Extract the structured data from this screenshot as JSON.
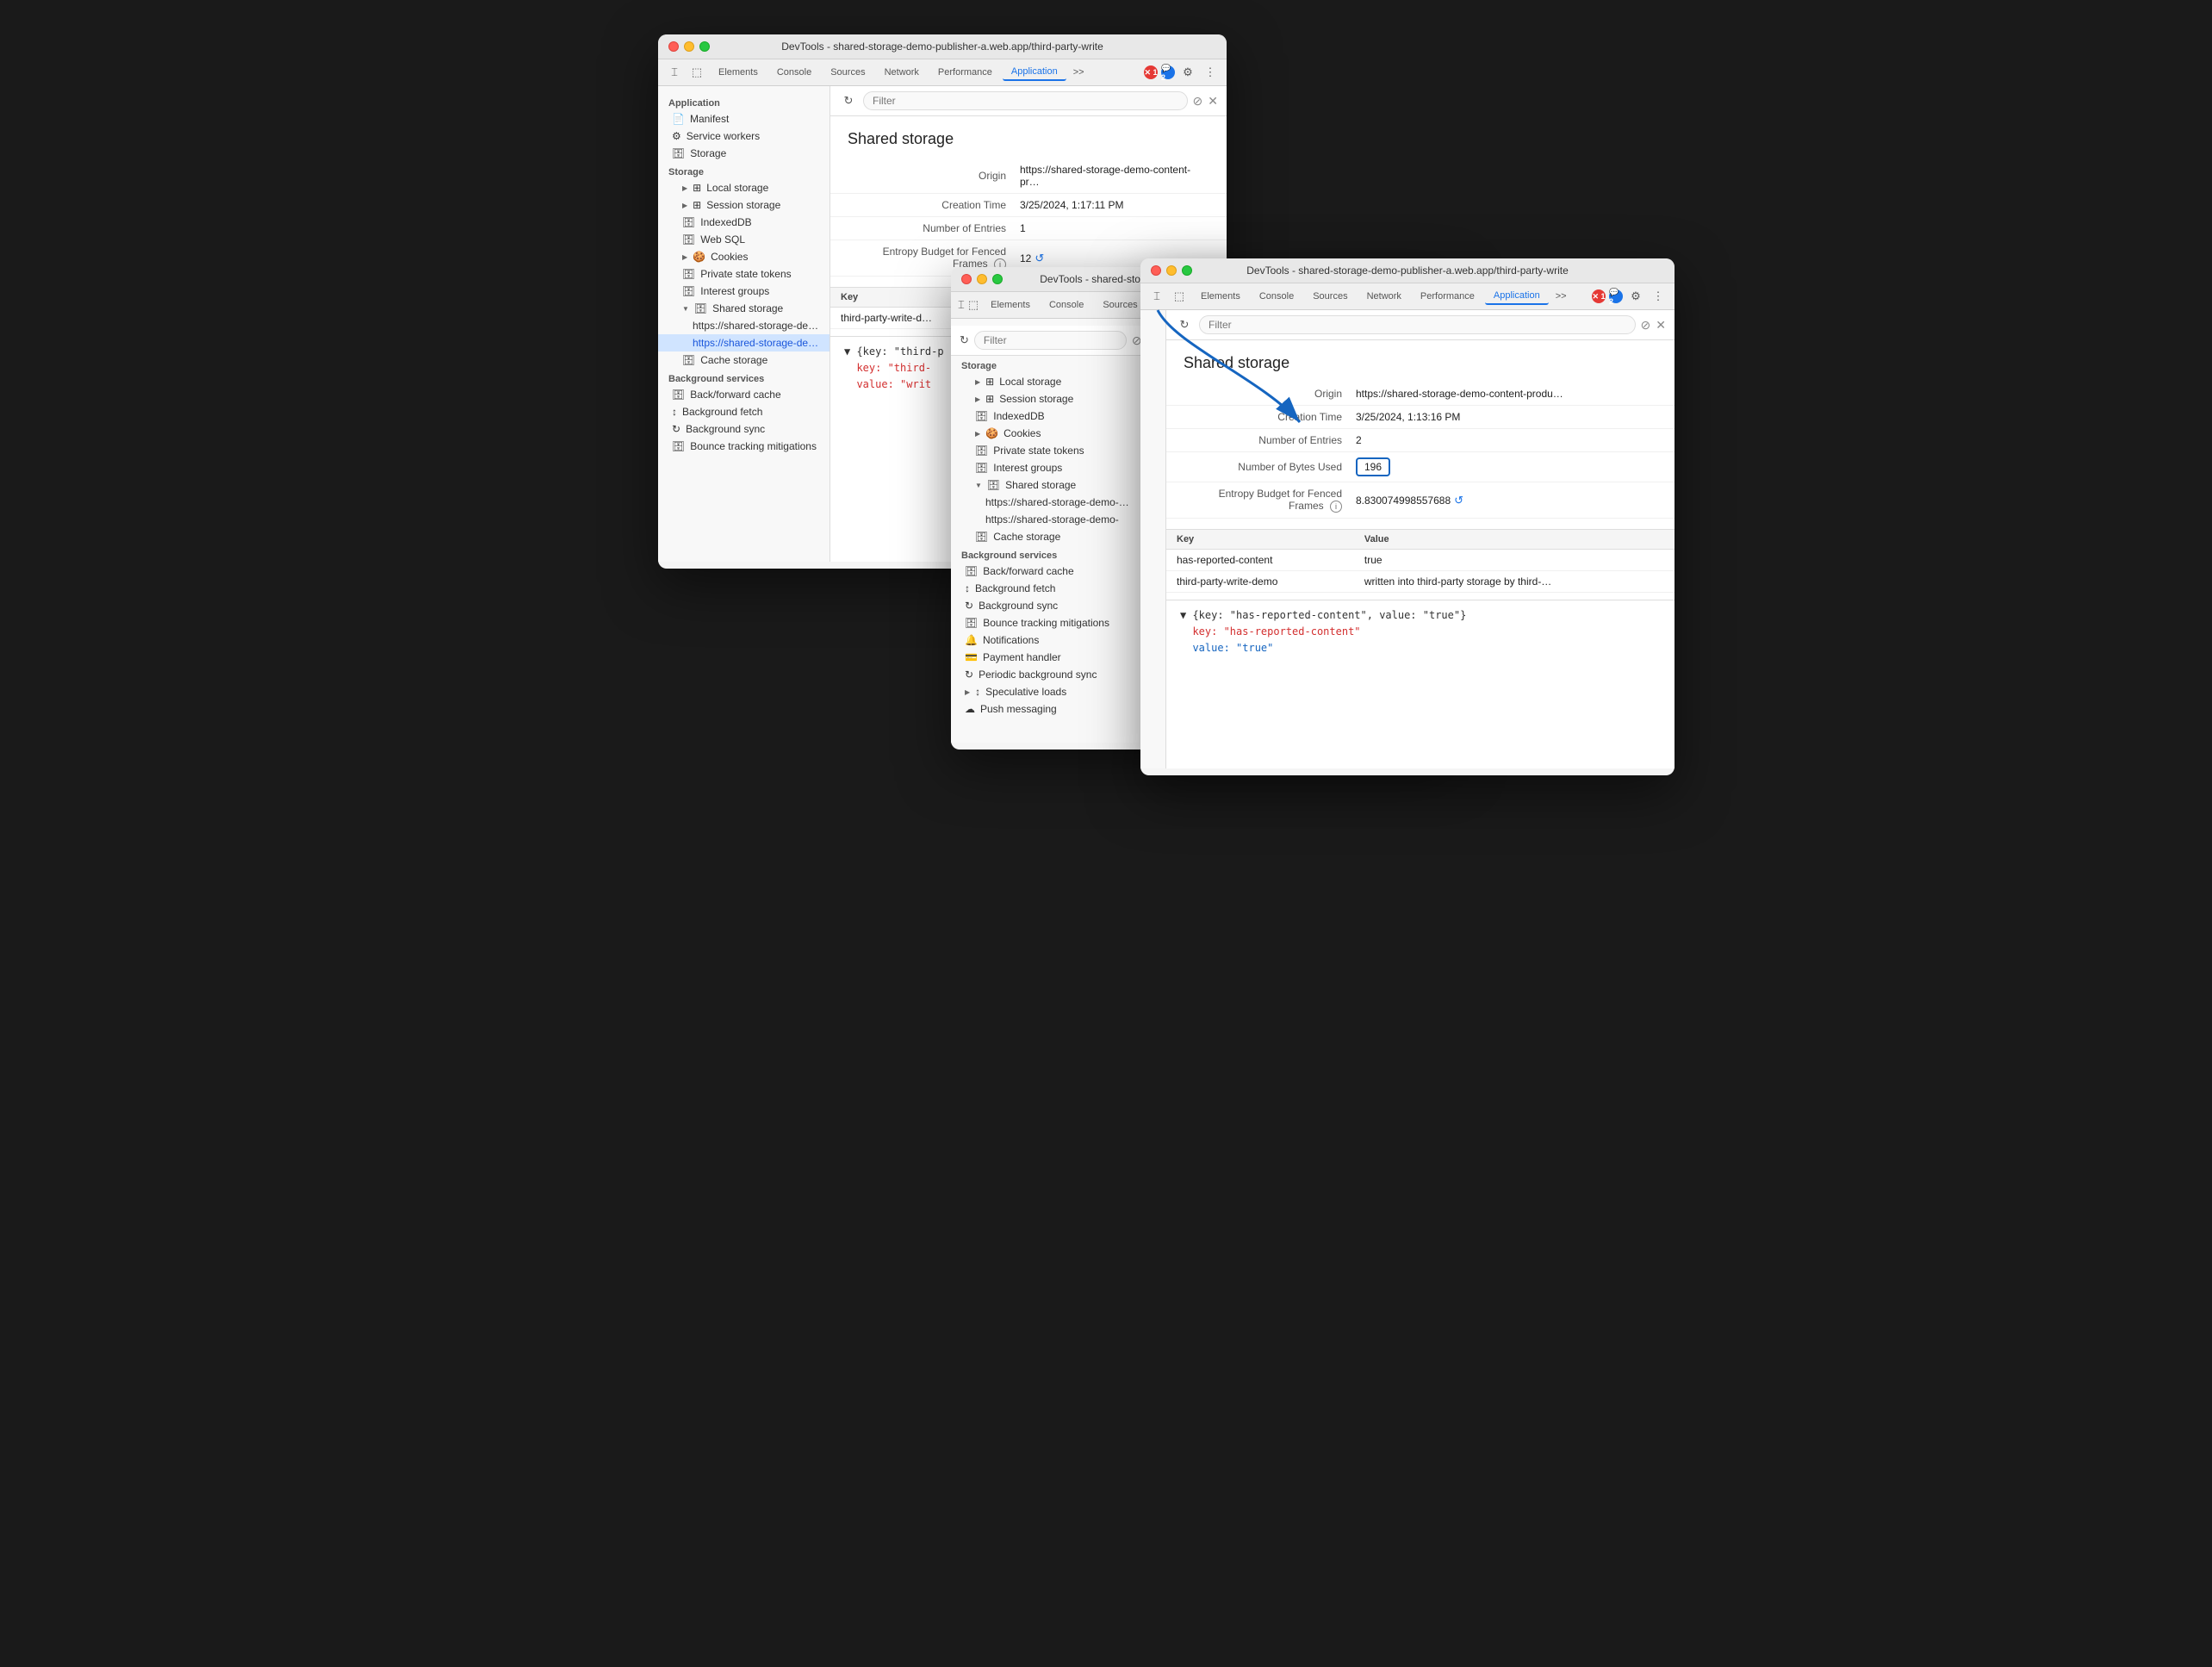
{
  "windows": {
    "back": {
      "title": "DevTools - shared-storage-demo-publisher-a.web.app/third-party-write",
      "tabs": [
        "Elements",
        "Console",
        "Sources",
        "Network",
        "Performance",
        "Application"
      ],
      "active_tab": "Application",
      "filter_placeholder": "Filter",
      "content_title": "Shared storage",
      "origin_label": "Origin",
      "origin_value": "https://shared-storage-demo-content-pr…",
      "creation_time_label": "Creation Time",
      "creation_time_value": "3/25/2024, 1:17:11 PM",
      "entries_label": "Number of Entries",
      "entries_value": "1",
      "entropy_label": "Entropy Budget for Fenced Frames",
      "entropy_value": "12",
      "table_headers": [
        "Key",
        "Value"
      ],
      "table_rows": [
        {
          "key": "third-party-write-d…",
          "value": ""
        }
      ],
      "json_lines": [
        {
          "type": "plain",
          "text": "▼ {key: \"third-p"
        },
        {
          "type": "key",
          "text": "  key: \"third-"
        },
        {
          "type": "key2",
          "text": "  value: \"writ"
        }
      ]
    },
    "mid": {
      "title": "DevTools - shared-storage-demo-publisher-a.web.app/third-party-write",
      "tabs": [
        "Elements",
        "Console",
        "Sources",
        "Network",
        "Performance",
        "Application"
      ],
      "active_tab": "Application",
      "filter_placeholder": "Filter",
      "storage_section": "Storage",
      "storage_items": [
        {
          "label": "Local storage",
          "icon": "grid",
          "indent": 1
        },
        {
          "label": "Session storage",
          "icon": "grid",
          "indent": 1
        },
        {
          "label": "IndexedDB",
          "icon": "db",
          "indent": 1
        },
        {
          "label": "Web SQL",
          "icon": "db",
          "indent": 1
        },
        {
          "label": "Cookies",
          "icon": "cookie",
          "indent": 1
        },
        {
          "label": "Private state tokens",
          "icon": "db",
          "indent": 1
        },
        {
          "label": "Interest groups",
          "icon": "db",
          "indent": 1
        },
        {
          "label": "Shared storage",
          "icon": "db",
          "indent": 1,
          "expanded": true
        },
        {
          "label": "https://shared-storage-demo-…",
          "icon": "",
          "indent": 2
        },
        {
          "label": "https://shared-storage-demo-",
          "icon": "",
          "indent": 2,
          "active": true
        },
        {
          "label": "Cache storage",
          "icon": "db",
          "indent": 1
        }
      ],
      "bg_section": "Background services",
      "bg_items": [
        {
          "label": "Back/forward cache",
          "icon": "db"
        },
        {
          "label": "Background fetch",
          "icon": "fetch"
        },
        {
          "label": "Background sync",
          "icon": "sync"
        },
        {
          "label": "Bounce tracking mitigations",
          "icon": "db"
        },
        {
          "label": "Notifications",
          "icon": "bell"
        },
        {
          "label": "Payment handler",
          "icon": "payment"
        },
        {
          "label": "Periodic background sync",
          "icon": "sync"
        },
        {
          "label": "Speculative loads",
          "icon": "arrow"
        },
        {
          "label": "Push messaging",
          "icon": "push"
        }
      ]
    },
    "front": {
      "title": "DevTools - shared-storage-demo-publisher-a.web.app/third-party-write",
      "tabs": [
        "Elements",
        "Console",
        "Sources",
        "Network",
        "Performance",
        "Application"
      ],
      "active_tab": "Application",
      "filter_placeholder": "Filter",
      "content_title": "Shared storage",
      "origin_label": "Origin",
      "origin_value": "https://shared-storage-demo-content-produ…",
      "creation_time_label": "Creation Time",
      "creation_time_value": "3/25/2024, 1:13:16 PM",
      "entries_label": "Number of Entries",
      "entries_value": "2",
      "bytes_label": "Number of Bytes Used",
      "bytes_value": "196",
      "entropy_label": "Entropy Budget for Fenced Frames",
      "entropy_value": "8.830074998557688",
      "table_headers": [
        "Key",
        "Value"
      ],
      "table_rows": [
        {
          "key": "has-reported-content",
          "value": "true"
        },
        {
          "key": "third-party-write-demo",
          "value": "written into third-party storage by third-…"
        }
      ],
      "json_lines": [
        {
          "text": "▼ {key: \"has-reported-content\", value: \"true\"}"
        },
        {
          "text": "  key: \"has-reported-content\"",
          "type": "key"
        },
        {
          "text": "  value: \"true\"",
          "type": "value"
        }
      ]
    }
  },
  "icons": {
    "close": "✕",
    "minimize": "−",
    "refresh": "↻",
    "clear": "⊘",
    "settings": "⚙",
    "more": "⋮",
    "info": "i",
    "reset": "↺",
    "expand": "▶",
    "collapse": "▼",
    "arrow_right": "▸"
  },
  "errors": {
    "count": "1"
  },
  "messages": {
    "count": "2"
  }
}
